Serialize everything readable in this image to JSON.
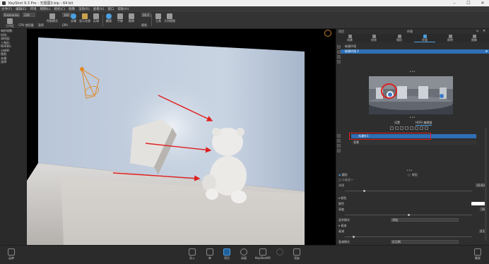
{
  "window": {
    "title": "KeyShot 9.3 Pro  -  无题图3.bip  -  64 bit",
    "controls": [
      "–",
      "☐",
      "✕"
    ]
  },
  "menu": [
    "文件(F)",
    "编辑(E)",
    "环境",
    "照明(L)",
    "相机(C)",
    "图像",
    "渲染(R)",
    "查看(V)",
    "窗口",
    "帮助(H)"
  ],
  "toolbar": {
    "workspace": "Enterprise",
    "count": "128",
    "zoom": "100",
    "right_value": "00.0",
    "buttons": [
      {
        "label": "工作区",
        "icon": "workspace-icon",
        "color": "#9a9a9a"
      },
      {
        "label": "CPU 使用量",
        "icon": "cpu-icon",
        "color": "#9a9a9a"
      },
      {
        "label": "暂停",
        "icon": "pause-icon",
        "color": "#9a9a9a"
      },
      {
        "label": "性能模式",
        "icon": "performance-icon",
        "color": "#9a9a9a"
      },
      {
        "label": "GPU",
        "icon": "gpu-icon",
        "color": "#9a9a9a"
      },
      {
        "label": "去噪",
        "icon": "denoise-icon",
        "color": "#4a9fe0"
      },
      {
        "label": "显示光源",
        "icon": "light-icon",
        "color": "#c9a24c"
      },
      {
        "label": "区域",
        "icon": "region-icon",
        "color": "#9a9a9a"
      },
      {
        "label": "翻滚",
        "icon": "tumble-icon",
        "color": "#4a9fe0"
      },
      {
        "label": "平移",
        "icon": "pan-icon",
        "color": "#9a9a9a"
      },
      {
        "label": "推移",
        "icon": "dolly-icon",
        "color": "#9a9a9a"
      },
      {
        "label": "视角",
        "icon": "view-icon",
        "color": "#9a9a9a"
      },
      {
        "label": "工具",
        "icon": "tools-icon",
        "color": "#9a9a9a"
      },
      {
        "label": "几何视图",
        "icon": "geometry-icon",
        "color": "#9a9a9a"
      }
    ]
  },
  "info": {
    "rows": [
      "每秒帧数:",
      "时间:",
      "采样值:",
      "三角形:",
      "NURBS:",
      "分辨率:",
      "焦距:",
      "去噪:",
      "选择:"
    ]
  },
  "panel": {
    "header_left": "项目",
    "header_center": "环境",
    "tabs": [
      {
        "label": "场景",
        "icon": "scene-icon"
      },
      {
        "label": "材质",
        "icon": "material-icon"
      },
      {
        "label": "相机",
        "icon": "camera-icon"
      },
      {
        "label": "环境",
        "icon": "environment-icon"
      },
      {
        "label": "照明",
        "icon": "lighting-icon"
      },
      {
        "label": "图像",
        "icon": "image-icon"
      }
    ],
    "environments": [
      "新建环境",
      "新建环境 2"
    ],
    "subtabs": {
      "settings": "设置",
      "hdri_editor": "HDRI 编辑器"
    },
    "pins": {
      "selected": "光源针1",
      "second": "背景"
    },
    "options": {
      "circle": "圆形",
      "rect": "矩形",
      "hdr_label": "□ 二分之一"
    },
    "properties": [
      {
        "label": "半径",
        "value": "16.92"
      },
      {
        "label": "颜色",
        "value": ""
      },
      {
        "label": "亮度",
        "value": "16"
      },
      {
        "label": "混合模式",
        "value": "添加"
      },
      {
        "label": "衰减",
        "value": "0.1"
      },
      {
        "label": "衰减模式",
        "value": "反比例"
      }
    ],
    "sections": {
      "color": "颜色",
      "falloff": "衰减"
    }
  },
  "bottom": {
    "left": {
      "label": "云库",
      "icon": "cloud-library-icon"
    },
    "right": {
      "label": "截屏",
      "icon": "screenshot-icon"
    },
    "buttons": [
      {
        "label": "导入",
        "icon": "import-icon"
      },
      {
        "label": "库",
        "icon": "library-icon"
      },
      {
        "label": "项目",
        "icon": "project-icon",
        "active": true
      },
      {
        "label": "动画",
        "icon": "animation-icon"
      },
      {
        "label": "KeyShotXR",
        "icon": "keyshotxr-icon"
      },
      {
        "label": "渲染",
        "icon": "render-icon"
      }
    ]
  },
  "colors": {
    "accent": "#4a9fe0",
    "annotation": "#e02020",
    "selected_row": "#2f6fb5",
    "light_gizmo": "#e08a2a"
  }
}
